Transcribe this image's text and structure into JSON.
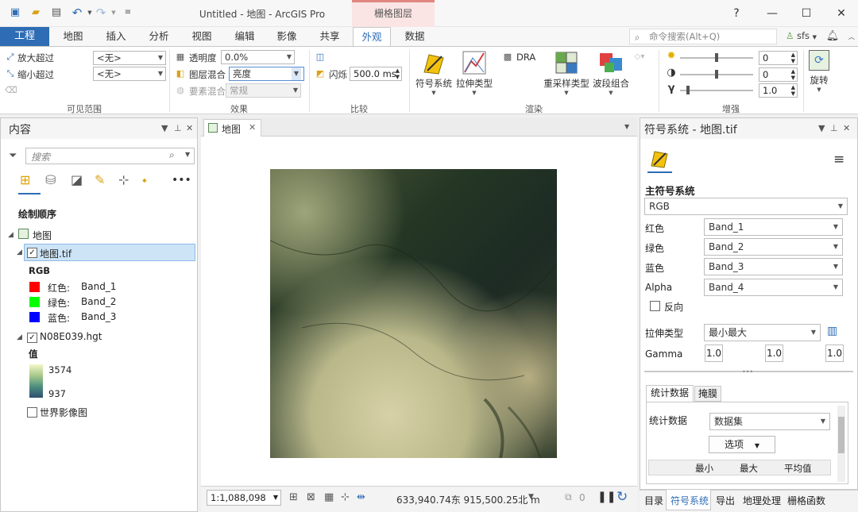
{
  "titlebar": {
    "app_title": "Untitled - 地图 - ArcGIS Pro",
    "context_tab": "栅格图层",
    "help": "?",
    "minimize": "—",
    "maximize": "☐",
    "close": "✕"
  },
  "tabs": {
    "project": "工程",
    "items": [
      "地图",
      "插入",
      "分析",
      "视图",
      "编辑",
      "影像",
      "共享",
      "外观",
      "数据"
    ],
    "active": "外观",
    "command_search_placeholder": "命令搜索(Alt+Q)",
    "user": "sfs"
  },
  "ribbon": {
    "visible_range": {
      "zoom_in_beyond": "放大超过",
      "zoom_out_beyond": "缩小超过",
      "zoom_in_value": "<无>",
      "zoom_out_value": "<无>",
      "group_label": "可见范围"
    },
    "effects": {
      "transparency_label": "透明度",
      "transparency_value": "0.0%",
      "layer_blend_label": "图层混合",
      "layer_blend_value": "亮度",
      "feature_blend_label": "要素混合",
      "feature_blend_value": "常规",
      "group_label": "效果"
    },
    "compare": {
      "flicker_label": "闪烁",
      "flicker_value": "500.0 ms",
      "group_label": "比较"
    },
    "rendering": {
      "symbology": "符号系统",
      "stretch_type": "拉伸类型",
      "dra": "DRA",
      "resample": "重采样类型",
      "band_combo": "波段组合",
      "group_label": "渲染"
    },
    "enhance": {
      "brightness": "0",
      "contrast": "0",
      "gamma": "1.0",
      "group_label": "增强"
    },
    "rotate": "旋转"
  },
  "contents": {
    "title": "内容",
    "search_placeholder": "搜索",
    "draw_order_label": "绘制顺序",
    "map_name": "地图",
    "layer1": {
      "name": "地图.tif",
      "renderer": "RGB",
      "bands": [
        {
          "label": "红色:",
          "band": "Band_1",
          "color": "#ff0000"
        },
        {
          "label": "绿色:",
          "band": "Band_2",
          "color": "#00ff00"
        },
        {
          "label": "蓝色:",
          "band": "Band_3",
          "color": "#0000ff"
        }
      ]
    },
    "layer2": {
      "name": "N08E039.hgt",
      "value_label": "值",
      "max": "3574",
      "min": "937"
    },
    "basemap": "世界影像图"
  },
  "mapview": {
    "tab": "地图",
    "scale": "1:1,088,098",
    "coords": "633,940.74东 915,500.25北 m",
    "selected_count": "0"
  },
  "symbology": {
    "title": "符号系统 - 地图.tif",
    "primary_label": "主符号系统",
    "renderer": "RGB",
    "channels": [
      {
        "label": "红色",
        "value": "Band_1"
      },
      {
        "label": "绿色",
        "value": "Band_2"
      },
      {
        "label": "蓝色",
        "value": "Band_3"
      },
      {
        "label": "Alpha",
        "value": "Band_4"
      }
    ],
    "invert_label": "反向",
    "stretch_label": "拉伸类型",
    "stretch_value": "最小最大",
    "gamma_label": "Gamma",
    "gamma_values": [
      "1.0",
      "1.0",
      "1.0"
    ],
    "tabs": [
      "统计数据",
      "掩膜"
    ],
    "stats_label": "统计数据",
    "stats_value": "数据集",
    "options_button": "选项",
    "table_headers": [
      "",
      "最小",
      "最大",
      "平均值"
    ]
  },
  "bottom_tabs": [
    "目录",
    "符号系统",
    "导出",
    "地理处理",
    "栅格函数"
  ],
  "colors": {
    "accent": "#2e6cb5",
    "context": "#fbe5e4",
    "selection": "#cde4f7"
  }
}
